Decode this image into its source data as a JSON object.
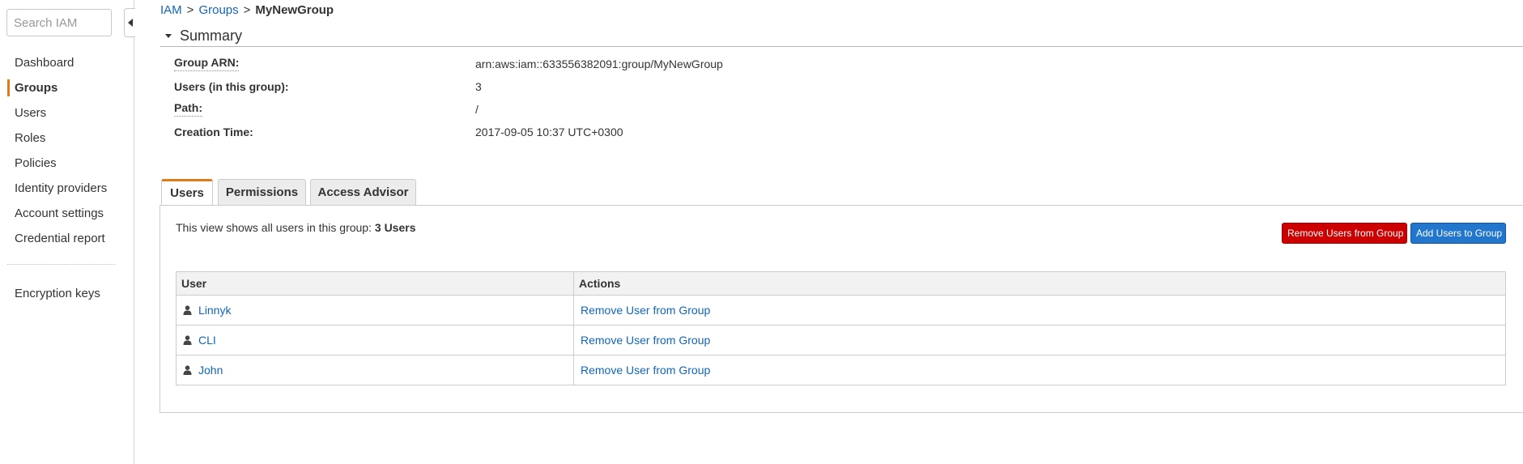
{
  "sidebar": {
    "search_placeholder": "Search IAM",
    "items": [
      {
        "label": "Dashboard"
      },
      {
        "label": "Groups"
      },
      {
        "label": "Users"
      },
      {
        "label": "Roles"
      },
      {
        "label": "Policies"
      },
      {
        "label": "Identity providers"
      },
      {
        "label": "Account settings"
      },
      {
        "label": "Credential report"
      }
    ],
    "bottom_items": [
      {
        "label": "Encryption keys"
      }
    ],
    "active_item": "Groups"
  },
  "breadcrumb": {
    "items": [
      "IAM",
      "Groups"
    ],
    "separator": ">",
    "current": "MyNewGroup"
  },
  "summary": {
    "title": "Summary",
    "rows": [
      {
        "key": "Group ARN:",
        "value": "arn:aws:iam::633556382091:group/MyNewGroup"
      },
      {
        "key": "Users (in this group):",
        "value": "3"
      },
      {
        "key": "Path:",
        "value": "/"
      },
      {
        "key": "Creation Time:",
        "value": "2017-09-05 10:37 UTC+0300"
      }
    ]
  },
  "tabs": [
    {
      "label": "Users"
    },
    {
      "label": "Permissions"
    },
    {
      "label": "Access Advisor"
    }
  ],
  "active_tab": "Users",
  "users_panel": {
    "intro_text": "This view shows all users in this group:",
    "intro_count": "3 Users",
    "remove_button": "Remove Users from Group",
    "add_button": "Add Users to Group",
    "columns": [
      "User",
      "Actions"
    ],
    "rows": [
      {
        "user": "Linnyk",
        "action": "Remove User from Group"
      },
      {
        "user": "CLI",
        "action": "Remove User from Group"
      },
      {
        "user": "John",
        "action": "Remove User from Group"
      }
    ]
  },
  "colors": {
    "accent": "#e07b1a",
    "link": "#1166bb",
    "danger_button": "#cc0000",
    "primary_button": "#2277cc"
  },
  "icons": {
    "user_row_icon": "user-icon",
    "collapse": "caret-left-icon",
    "summary_toggle": "caret-down-icon"
  }
}
